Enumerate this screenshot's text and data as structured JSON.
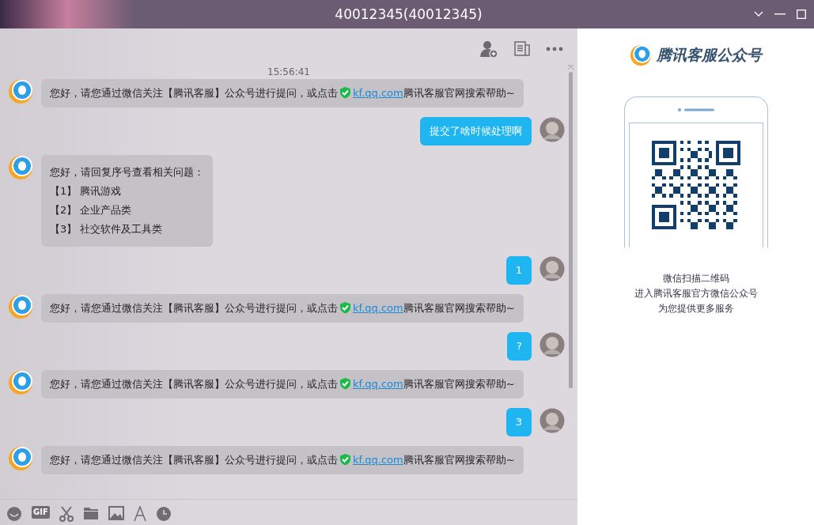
{
  "window": {
    "title": "40012345(40012345)"
  },
  "chat": {
    "timestamp": "15:56:41",
    "messages": [
      {
        "kind": "bot_link_notice",
        "before": "您好，请您通过微信关注【腾讯客服】公众号进行提问，或点击",
        "link": "kf.qq.com",
        "after": "腾讯客服官网搜索帮助~"
      },
      {
        "kind": "user_text",
        "text": "提交了啥时候处理啊"
      },
      {
        "kind": "bot_lines",
        "lines": [
          "您好，请回复序号查看相关问题：",
          "【1】 腾讯游戏",
          "【2】 企业产品类",
          "【3】 社交软件及工具类"
        ]
      },
      {
        "kind": "user_text",
        "text": "1"
      },
      {
        "kind": "bot_link_notice",
        "before": "您好，请您通过微信关注【腾讯客服】公众号进行提问，或点击",
        "link": "kf.qq.com",
        "after": "腾讯客服官网搜索帮助~"
      },
      {
        "kind": "user_text",
        "text": "?"
      },
      {
        "kind": "bot_link_notice",
        "before": "您好，请您通过微信关注【腾讯客服】公众号进行提问，或点击",
        "link": "kf.qq.com",
        "after": "腾讯客服官网搜索帮助~"
      },
      {
        "kind": "user_text",
        "text": "3"
      },
      {
        "kind": "bot_link_notice",
        "before": "您好，请您通过微信关注【腾讯客服】公众号进行提问，或点击",
        "link": "kf.qq.com",
        "after": "腾讯客服官网搜索帮助~"
      }
    ]
  },
  "toolbar": {
    "gif_label": "GIF"
  },
  "side_panel": {
    "title": "腾讯客服公众号",
    "captions": [
      "微信扫描二维码",
      "进入腾讯客服官方微信公众号",
      "为您提供更多服务"
    ]
  }
}
